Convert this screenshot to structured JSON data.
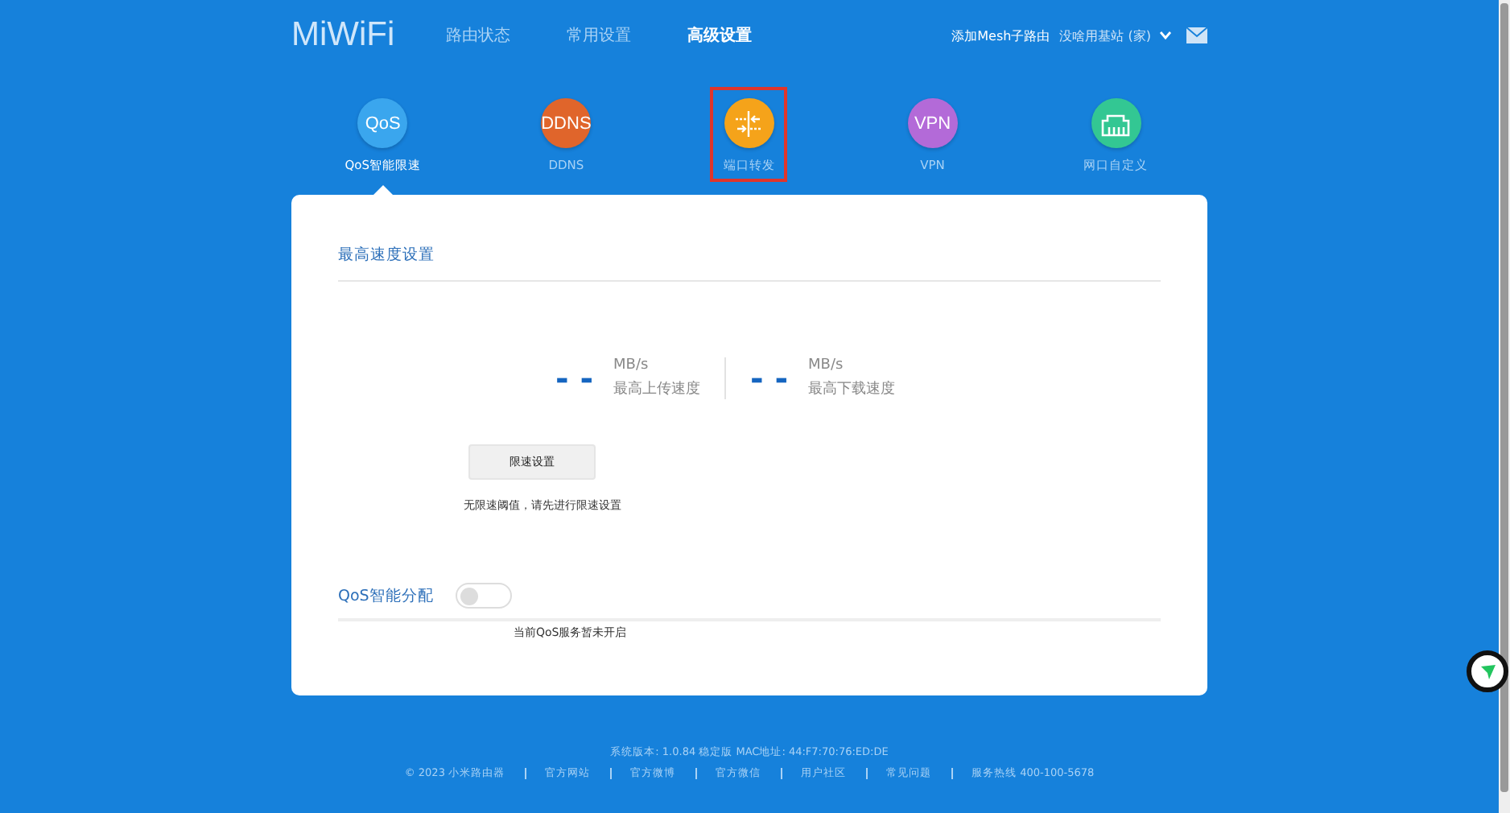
{
  "header": {
    "logo": "MiWiFi",
    "nav": [
      {
        "label": "路由状态",
        "selected": false
      },
      {
        "label": "常用设置",
        "selected": false
      },
      {
        "label": "高级设置",
        "selected": true
      }
    ],
    "mesh_link": "添加Mesh子路由",
    "router_name": "没啥用基站 (家)"
  },
  "features": [
    {
      "icon_text": "QoS",
      "label": "QoS智能限速",
      "color": "#3aa6ee",
      "selected": true,
      "highlighted": false
    },
    {
      "icon_text": "DDNS",
      "label": "DDNS",
      "color": "#e0652b",
      "selected": false,
      "highlighted": false
    },
    {
      "kind": "ports",
      "label": "端口转发",
      "color": "#f5a31a",
      "selected": false,
      "highlighted": true
    },
    {
      "icon_text": "VPN",
      "label": "VPN",
      "color": "#b36ad8",
      "selected": false,
      "highlighted": false
    },
    {
      "kind": "lan",
      "label": "网口自定义",
      "color": "#33c793",
      "selected": false,
      "highlighted": false
    }
  ],
  "speed": {
    "title": "最高速度设置",
    "meters": [
      {
        "value": "- -",
        "unit": "MB/s",
        "label": "最高上传速度"
      },
      {
        "value": "- -",
        "unit": "MB/s",
        "label": "最高下载速度"
      }
    ],
    "button": "限速设置",
    "hint": "无限速阈值，请先进行限速设置"
  },
  "qos": {
    "title": "QoS智能分配",
    "on": false,
    "status": "当前QoS服务暂未开启"
  },
  "footer": {
    "version": "系统版本: 1.0.84 稳定版  MAC地址: 44:F7:70:76:ED:DE",
    "links": [
      "© 2023 小米路由器",
      "官方网站",
      "官方微博",
      "官方微信",
      "用户社区",
      "常见问题",
      "服务热线 400-100-5678"
    ]
  }
}
